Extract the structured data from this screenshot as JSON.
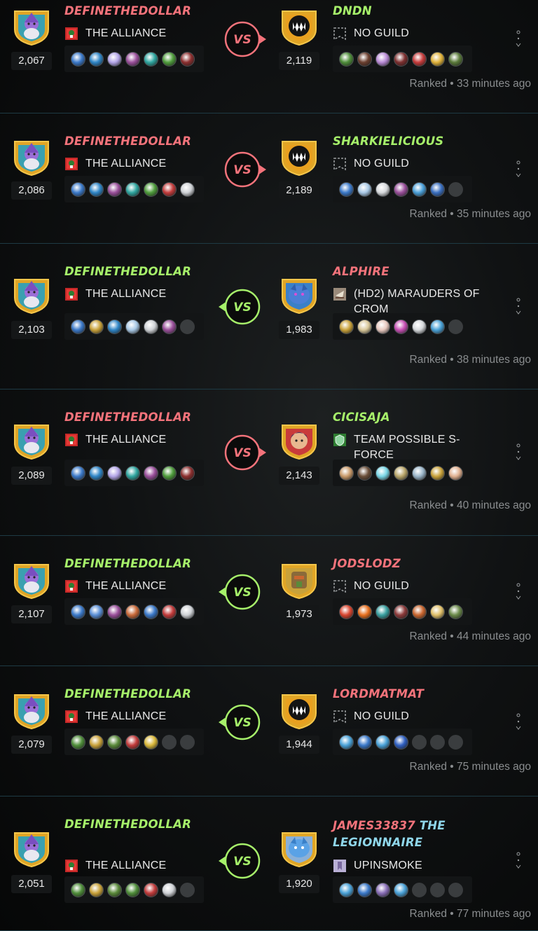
{
  "battles": [
    {
      "left": {
        "name": "DEFINETHEDOLLAR",
        "result": "lose",
        "guild": "THE ALLIANCE",
        "guild_icon": "alliance-banner-icon",
        "rating": "2,067",
        "avatar": "wizard",
        "cards": [
          "#3b79c9",
          "#2f86c7",
          "#b4a6e8",
          "#9a4f9b",
          "#2fa6a0",
          "#4f9d3c",
          "#8c2f2f"
        ]
      },
      "right": {
        "name": "DNDN",
        "result": "win",
        "guild": "NO GUILD",
        "guild_icon": "no-guild-icon",
        "rating": "2,119",
        "avatar": "default",
        "cards": [
          "#4f8e3a",
          "#6b3f2f",
          "#b98bd6",
          "#7d2f2f",
          "#c63b3b",
          "#e0b23a",
          "#5a7a3a"
        ]
      },
      "vs_direction": "right",
      "meta": "Ranked • 33 minutes ago"
    },
    {
      "left": {
        "name": "DEFINETHEDOLLAR",
        "result": "lose",
        "guild": "THE ALLIANCE",
        "guild_icon": "alliance-banner-icon",
        "rating": "2,086",
        "avatar": "wizard",
        "cards": [
          "#3b79c9",
          "#2f86c7",
          "#9a4f9b",
          "#2fa6a0",
          "#4f9d3c",
          "#c23b3b",
          "#cfd2d6"
        ]
      },
      "right": {
        "name": "SHARKIELICIOUS",
        "result": "win",
        "guild": "NO GUILD",
        "guild_icon": "no-guild-icon",
        "rating": "2,189",
        "avatar": "default",
        "cards": [
          "#3b79c9",
          "#a9c9e6",
          "#d6d9dc",
          "#9a4f9b",
          "#4a9fd8",
          "#3a6fc0",
          "empty"
        ]
      },
      "vs_direction": "right",
      "meta": "Ranked • 35 minutes ago"
    },
    {
      "left": {
        "name": "DEFINETHEDOLLAR",
        "result": "win",
        "guild": "THE ALLIANCE",
        "guild_icon": "alliance-banner-icon",
        "rating": "2,103",
        "avatar": "wizard",
        "cards": [
          "#3b79c9",
          "#c9a23a",
          "#2f86c7",
          "#a9c9e6",
          "#cfd2d6",
          "#9a4f9b",
          "empty"
        ]
      },
      "right": {
        "name": "ALPHIRE",
        "result": "lose",
        "guild": "(HD2) MARAUDERS OF CROM",
        "guild_icon": "marauders-guild-icon",
        "rating": "1,983",
        "avatar": "dragon",
        "cards": [
          "#c9a23a",
          "#d9c89a",
          "#e8c9c0",
          "#c64fb4",
          "#d6d9dc",
          "#4aa2d8",
          "empty"
        ]
      },
      "vs_direction": "left",
      "meta": "Ranked • 38 minutes ago"
    },
    {
      "left": {
        "name": "DEFINETHEDOLLAR",
        "result": "lose",
        "guild": "THE ALLIANCE",
        "guild_icon": "alliance-banner-icon",
        "rating": "2,089",
        "avatar": "wizard",
        "cards": [
          "#3b79c9",
          "#2f86c7",
          "#b4a6e8",
          "#2fa6a0",
          "#9a4f9b",
          "#4f9d3c",
          "#8c2f2f"
        ]
      },
      "right": {
        "name": "CICISAJA",
        "result": "win",
        "guild": "TEAM POSSIBLE S-FORCE",
        "guild_icon": "team-possible-guild-icon",
        "rating": "2,143",
        "avatar": "girl",
        "cards": [
          "#c99a6a",
          "#6b4f3a",
          "#7ad6e6",
          "#b9a66a",
          "#9ab5c9",
          "#c9a23a",
          "#e0b090"
        ]
      },
      "vs_direction": "right",
      "meta": "Ranked • 40 minutes ago"
    },
    {
      "left": {
        "name": "DEFINETHEDOLLAR",
        "result": "win",
        "guild": "THE ALLIANCE",
        "guild_icon": "alliance-banner-icon",
        "rating": "2,107",
        "avatar": "wizard",
        "cards": [
          "#3b79c9",
          "#5a8fd6",
          "#9a4f9b",
          "#c96a3a",
          "#3b79c9",
          "#c23b3b",
          "#cfd2d6"
        ]
      },
      "right": {
        "name": "JODSLODZ",
        "result": "lose",
        "guild": "NO GUILD",
        "guild_icon": "no-guild-icon",
        "rating": "1,973",
        "avatar": "rock",
        "cards": [
          "#d9452f",
          "#e8701f",
          "#3aa0a0",
          "#8c3a3a",
          "#c9662f",
          "#e0c06a",
          "#6b8a4a"
        ]
      },
      "vs_direction": "left",
      "meta": "Ranked • 44 minutes ago"
    },
    {
      "left": {
        "name": "DEFINETHEDOLLAR",
        "result": "win",
        "guild": "THE ALLIANCE",
        "guild_icon": "alliance-banner-icon",
        "rating": "2,079",
        "avatar": "wizard",
        "cards": [
          "#4f8e3a",
          "#c9a23a",
          "#5a8a3a",
          "#c23b3b",
          "#d9b83a",
          "empty",
          "empty"
        ]
      },
      "right": {
        "name": "LORDMATMAT",
        "result": "lose",
        "guild": "NO GUILD",
        "guild_icon": "no-guild-icon",
        "rating": "1,944",
        "avatar": "default",
        "cards": [
          "#4aa2d8",
          "#3b79c9",
          "#4aa2d8",
          "#2f5fc0",
          "empty",
          "empty",
          "empty"
        ]
      },
      "vs_direction": "left",
      "meta": "Ranked • 75 minutes ago"
    },
    {
      "left": {
        "name": "DEFINETHEDOLLAR",
        "result": "win",
        "guild": "THE ALLIANCE",
        "guild_icon": "alliance-banner-icon",
        "rating": "2,051",
        "avatar": "wizard",
        "cards": [
          "#4f8e3a",
          "#c9a23a",
          "#5a8a3a",
          "#4f8e3a",
          "#c23b3b",
          "#cfd2d6",
          "empty"
        ]
      },
      "right": {
        "name": "JAMES33837",
        "name_suffix": "THE LEGIONNAIRE",
        "result": "lose",
        "guild": "UPINSMOKE",
        "guild_icon": "upinsmoke-guild-icon",
        "rating": "1,920",
        "avatar": "dragon-blue",
        "cards": [
          "#4aa2d8",
          "#3b79c9",
          "#8a6fb8",
          "#4aa2d8",
          "empty",
          "empty",
          "empty"
        ]
      },
      "vs_direction": "left",
      "meta": "Ranked • 77 minutes ago"
    }
  ],
  "colors": {
    "win": "#a6f06a",
    "lose": "#f4737b",
    "vs_win_ring": "#a6f06a",
    "vs_lose_ring": "#f4737b"
  }
}
